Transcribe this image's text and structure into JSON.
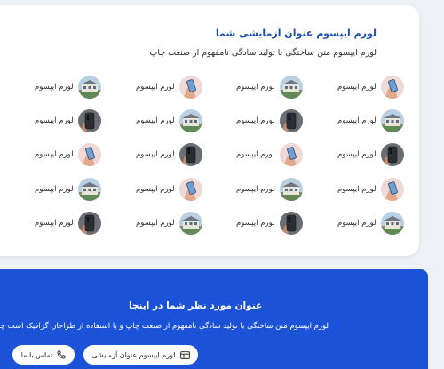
{
  "card": {
    "title": "لورم ایپسوم عنوان آزمایشی شما",
    "subtitle": "لورم ایپسوم متن ساختگی با تولید سادگی نامفهوم از صنعت چاپ"
  },
  "grid": {
    "rows": [
      [
        {
          "label": "لورم ایپسوم",
          "image": "phone-hand"
        },
        {
          "label": "لورم ایپسوم",
          "image": "building"
        },
        {
          "label": "لورم ایپسوم",
          "image": "phone-hand"
        },
        {
          "label": "لورم ایپسوم",
          "image": "building"
        }
      ],
      [
        {
          "label": "لورم ایپسوم",
          "image": "building"
        },
        {
          "label": "لورم ایپسوم",
          "image": "phone-dark"
        },
        {
          "label": "لورم ایپسوم",
          "image": "building"
        },
        {
          "label": "لورم ایپسوم",
          "image": "phone-dark"
        }
      ],
      [
        {
          "label": "لورم ایپسوم",
          "image": "phone-dark"
        },
        {
          "label": "لورم ایپسوم",
          "image": "phone-hand"
        },
        {
          "label": "لورم ایپسوم",
          "image": "phone-dark"
        },
        {
          "label": "لورم ایپسوم",
          "image": "phone-hand"
        }
      ],
      [
        {
          "label": "لورم ایپسوم",
          "image": "phone-hand"
        },
        {
          "label": "لورم ایپسوم",
          "image": "building"
        },
        {
          "label": "لورم ایپسوم",
          "image": "phone-hand"
        },
        {
          "label": "لورم ایپسوم",
          "image": "building"
        }
      ],
      [
        {
          "label": "لورم ایپسوم",
          "image": "building"
        },
        {
          "label": "لورم ایپسوم",
          "image": "phone-dark"
        },
        {
          "label": "لورم ایپسوم",
          "image": "building"
        },
        {
          "label": "لورم ایپسوم",
          "image": "phone-dark"
        }
      ]
    ]
  },
  "banner": {
    "title": "عنوان مورد نظر شما در اینجا",
    "text": "لورم ایپسوم متن ساختگی با تولید سادگی نامفهوم از صنعت چاپ و با استفاده از طراحان گرافیک است چاپگرها .",
    "demo_button": {
      "label": "لورم ایپسوم عنوان آزمایشی",
      "icon": "layout-icon"
    },
    "contact_button": {
      "label": "تماس با ما",
      "icon": "phone-icon"
    }
  },
  "colors": {
    "accent": "#1b4db3",
    "banner_bg": "#1c52d8",
    "page_bg": "#eef1f6"
  }
}
